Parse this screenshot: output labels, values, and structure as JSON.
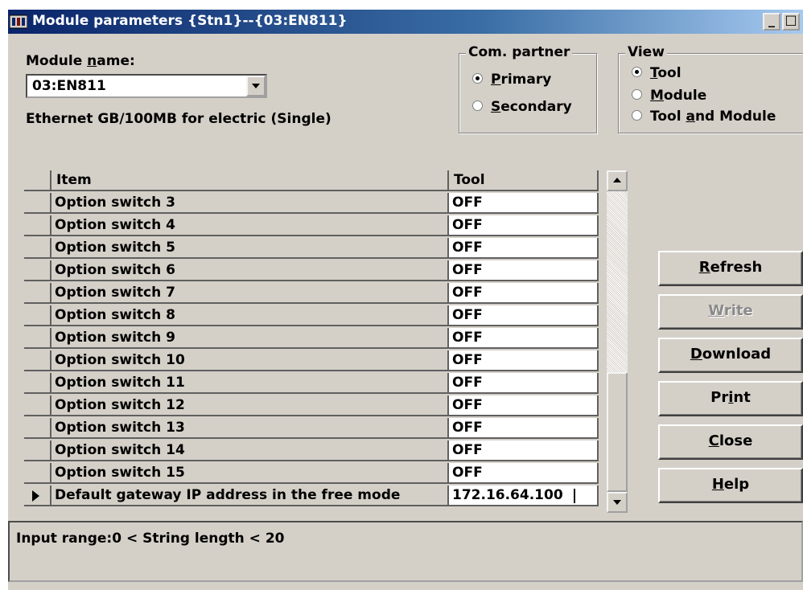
{
  "window": {
    "title": "Module parameters {Stn1}--{03:EN811}",
    "minimize_glyph": "_",
    "maximize_glyph": "□"
  },
  "module": {
    "label_pre": "Module ",
    "label_ul": "n",
    "label_post": "ame:",
    "value": "03:EN811",
    "description": "Ethernet GB/100MB for electric (Single)"
  },
  "com_partner": {
    "legend": "Com. partner",
    "options": [
      {
        "ul": "P",
        "rest": "rimary",
        "selected": true
      },
      {
        "ul": "S",
        "rest": "econdary",
        "selected": false
      }
    ]
  },
  "view": {
    "legend": "View",
    "options": [
      {
        "pre": "",
        "ul": "T",
        "rest": "ool",
        "selected": true
      },
      {
        "pre": "",
        "ul": "M",
        "rest": "odule",
        "selected": false
      },
      {
        "pre": "Tool ",
        "ul": "a",
        "rest": "nd Module",
        "selected": false
      }
    ]
  },
  "grid": {
    "header_item": "Item",
    "header_tool": "Tool",
    "rows": [
      {
        "item": "Option switch 3",
        "tool": "OFF"
      },
      {
        "item": "Option switch 4",
        "tool": "OFF"
      },
      {
        "item": "Option switch 5",
        "tool": "OFF"
      },
      {
        "item": "Option switch 6",
        "tool": "OFF"
      },
      {
        "item": "Option switch 7",
        "tool": "OFF"
      },
      {
        "item": "Option switch 8",
        "tool": "OFF"
      },
      {
        "item": "Option switch 9",
        "tool": "OFF"
      },
      {
        "item": "Option switch 10",
        "tool": "OFF"
      },
      {
        "item": "Option switch 11",
        "tool": "OFF"
      },
      {
        "item": "Option switch 12",
        "tool": "OFF"
      },
      {
        "item": "Option switch 13",
        "tool": "OFF"
      },
      {
        "item": "Option switch 14",
        "tool": "OFF"
      },
      {
        "item": "Option switch 15",
        "tool": "OFF"
      },
      {
        "item": "Default gateway IP address in the free mode",
        "tool": "172.16.64.100",
        "current": true
      }
    ]
  },
  "buttons": [
    {
      "id": "refresh",
      "pre": "",
      "ul": "R",
      "rest": "efresh",
      "enabled": true
    },
    {
      "id": "write",
      "pre": "",
      "ul": "W",
      "rest": "rite",
      "enabled": false
    },
    {
      "id": "download",
      "pre": "",
      "ul": "D",
      "rest": "ownload",
      "enabled": true
    },
    {
      "id": "print",
      "pre": "Pr",
      "ul": "i",
      "rest": "nt",
      "enabled": true
    },
    {
      "id": "close",
      "pre": "",
      "ul": "C",
      "rest": "lose",
      "enabled": true
    },
    {
      "id": "help",
      "pre": "",
      "ul": "H",
      "rest": "elp",
      "enabled": true
    }
  ],
  "status": {
    "text": "Input range:0 < String length < 20"
  }
}
